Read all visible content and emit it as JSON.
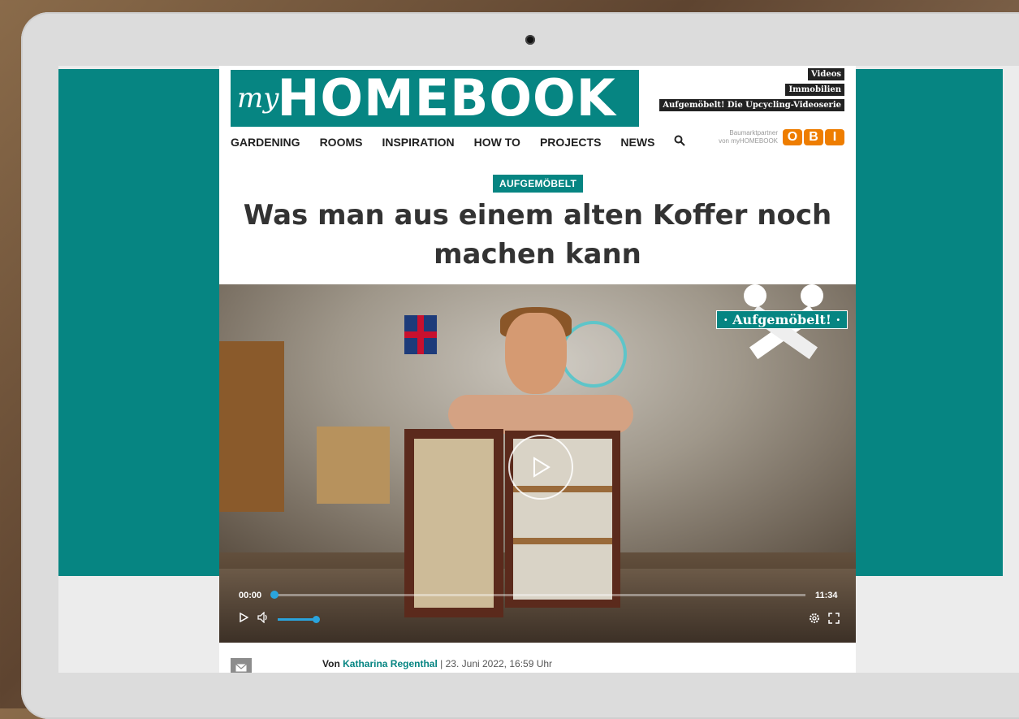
{
  "site": {
    "logo_prefix": "my",
    "logo_main": "HOMEBOOK",
    "top_links": [
      "Videos",
      "Immobilien",
      "Aufgemöbelt! Die Upcycling-Videoserie"
    ],
    "nav": [
      "GARDENING",
      "ROOMS",
      "INSPIRATION",
      "HOW TO",
      "PROJECTS",
      "NEWS"
    ],
    "partner_line1": "Baumarktpartner",
    "partner_line2": "von myHOMEBOOK",
    "partner_logo": [
      "O",
      "B",
      "I"
    ]
  },
  "article": {
    "kicker": "AUFGEMÖBELT",
    "title": "Was man aus einem alten Koffer noch machen kann",
    "author_prefix": "Von",
    "author": "Katharina Regenthal",
    "date": "| 23. Juni 2022, 16:59 Uhr"
  },
  "video": {
    "badge": "· Aufgemöbelt! ·",
    "current_time": "00:00",
    "duration": "11:34",
    "progress": 0,
    "volume": 1.0
  },
  "colors": {
    "brand_teal": "#068582",
    "player_accent": "#2aa4dd",
    "obi_orange": "#ee7d00"
  }
}
